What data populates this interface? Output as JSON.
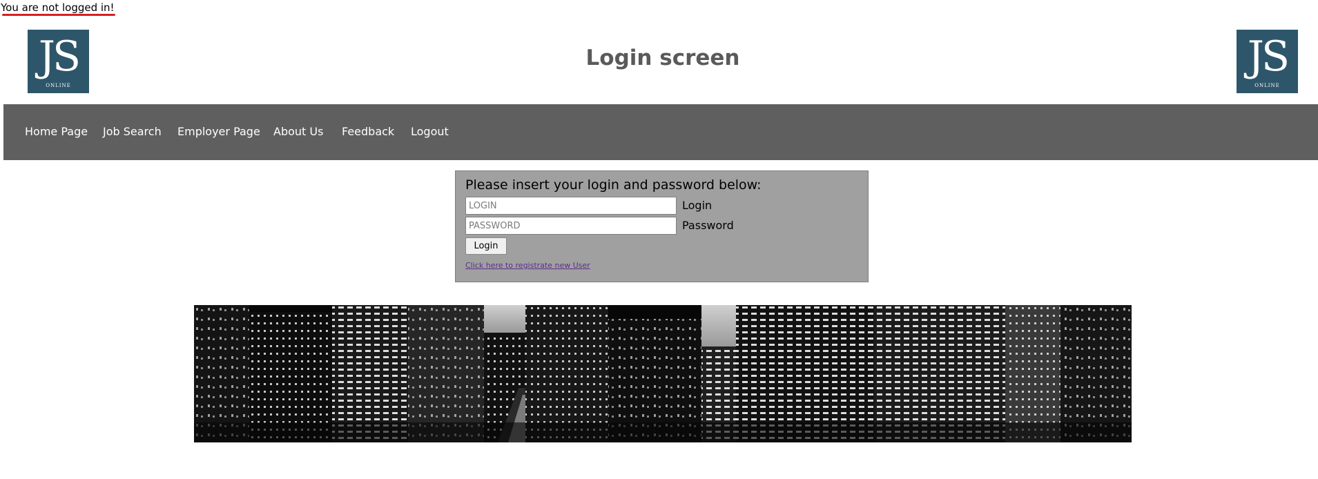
{
  "status": {
    "text": "You are not logged in!",
    "underline_color": "#d62020"
  },
  "header": {
    "title": "Login screen",
    "logo": {
      "mark": "JS",
      "sub": "ONLINE",
      "color": "#2e566a"
    }
  },
  "nav": {
    "background": "#5f5f5f",
    "items": [
      {
        "label": "Home Page"
      },
      {
        "label": "Job Search"
      },
      {
        "label": "Employer Page"
      },
      {
        "label": "About Us"
      },
      {
        "label": "Feedback"
      },
      {
        "label": "Logout"
      }
    ]
  },
  "login_form": {
    "prompt": "Please insert your login and password below:",
    "login_field": {
      "placeholder": "LOGIN",
      "value": "",
      "label": "Login"
    },
    "password_field": {
      "placeholder": "PASSWORD",
      "value": "",
      "label": "Password"
    },
    "submit_label": "Login",
    "register_link": "Click here to registrate new User",
    "background": "#a0a0a0"
  },
  "banner": {
    "icon": "city-skyline-night-image"
  }
}
